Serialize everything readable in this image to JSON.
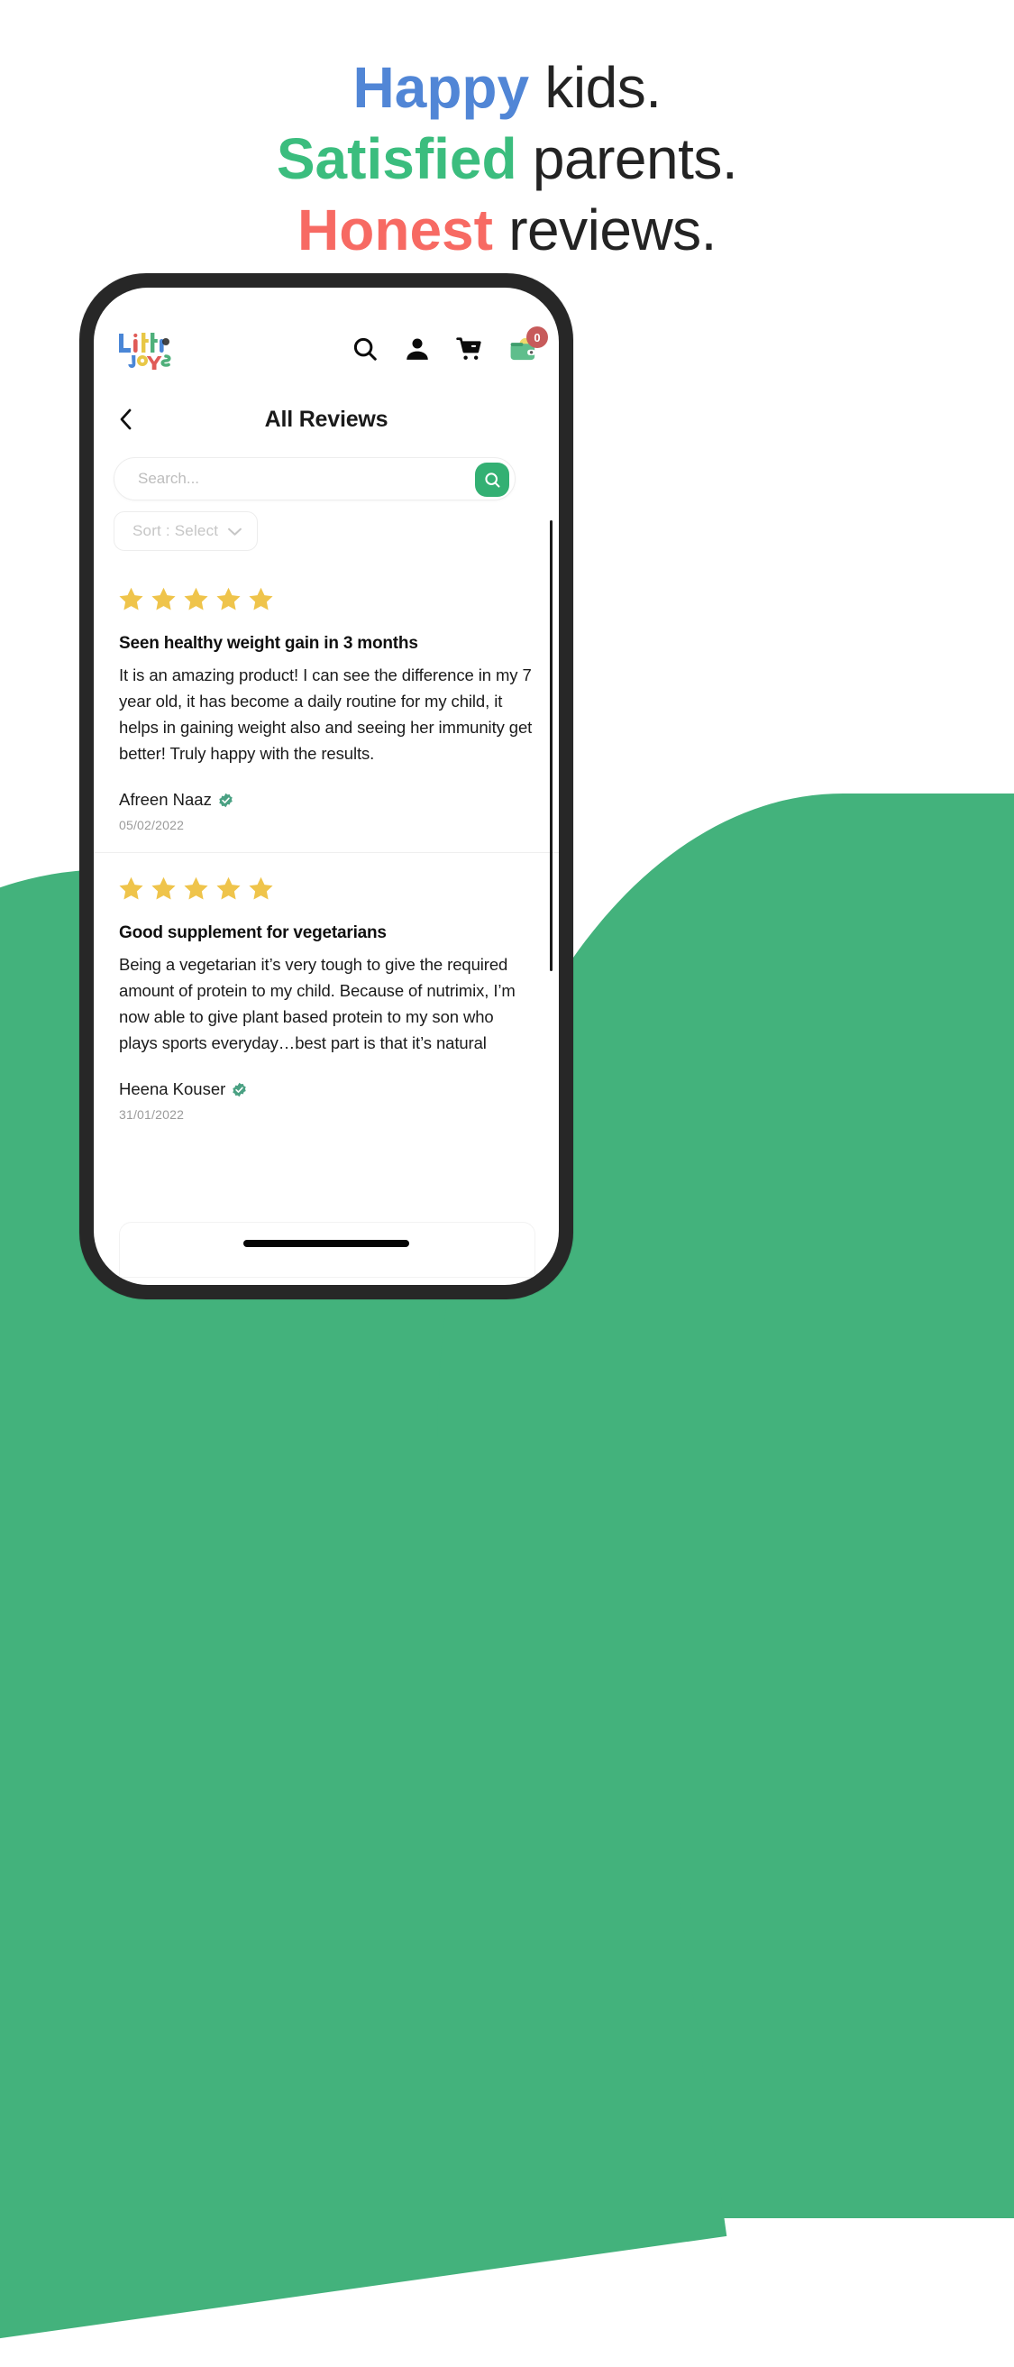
{
  "headline": {
    "line1_accent": "Happy",
    "line1_rest": " kids.",
    "line2_accent": "Satisfied",
    "line2_rest": " parents.",
    "line3_accent": "Honest",
    "line3_rest": " reviews.",
    "colors": {
      "happy": "#5186D6",
      "satisfied": "#3BBD7E",
      "honest": "#F76A63",
      "plain": "#232323"
    }
  },
  "background": {
    "page": "#FFFFFF",
    "accent_green": "#43B27C"
  },
  "app": {
    "brand": {
      "name": "Little Joys",
      "word1": "Little",
      "word2": "Joys",
      "icon": "little-joys-logo"
    },
    "nav_icons": [
      {
        "name": "search-icon",
        "label": "Search"
      },
      {
        "name": "user-icon",
        "label": "Account"
      },
      {
        "name": "cart-icon",
        "label": "Cart"
      },
      {
        "name": "wallet-icon",
        "label": "Wallet"
      }
    ],
    "wallet_badge_count": "0",
    "wallet_badge_color": "#C75B5B",
    "back_icon": "chevron-left-icon",
    "page_title": "All Reviews",
    "search": {
      "placeholder": "Search...",
      "value": "",
      "button_icon": "search-icon",
      "button_color": "#33B073"
    },
    "sort": {
      "label": "Sort : Select",
      "chevron_icon": "chevron-down-icon"
    },
    "star_color": "#EFC44B",
    "verified_color": "#4AA183",
    "reviews": [
      {
        "rating": 5,
        "title": "Seen healthy weight gain in 3 months",
        "body": "It is an amazing product! I can see the difference in my 7 year old, it has become a daily routine for my child, it helps in gaining weight also and seeing her immunity get better! Truly happy with the results.",
        "author": "Afreen Naaz",
        "verified": true,
        "date": "05/02/2022"
      },
      {
        "rating": 5,
        "title": "Good supplement for vegetarians",
        "body": "Being a vegetarian it’s very tough to give the required amount of protein to my child. Because of nutrimix, I’m now able to give plant based protein to my son who plays sports everyday…best part is that it’s natural",
        "author": "Heena Kouser",
        "verified": true,
        "date": "31/01/2022"
      }
    ]
  }
}
